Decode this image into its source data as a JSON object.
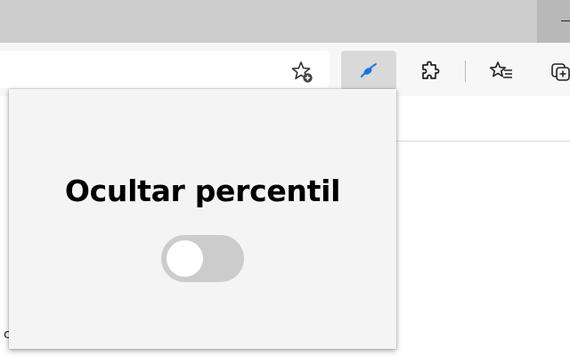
{
  "window": {
    "minimize_label": "—"
  },
  "toolbar": {
    "icons": {
      "favorite": "star-add-icon",
      "active_extension": "extension-active-icon",
      "extensions": "puzzle-icon",
      "favorites": "favorites-list-icon",
      "collections": "collections-icon"
    }
  },
  "popup": {
    "title": "Ocultar percentil",
    "toggle_on": false
  },
  "page": {
    "fragment": "c"
  },
  "colors": {
    "accent": "#1a73e8",
    "toggle_off": "#cccccc"
  }
}
